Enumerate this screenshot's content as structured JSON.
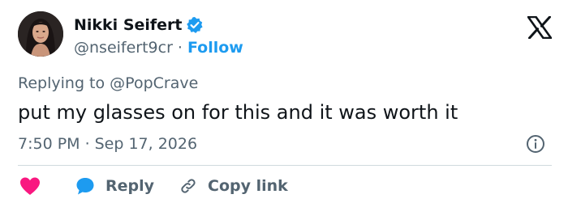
{
  "author": {
    "display_name": "Nikki Seifert",
    "handle": "@nseifert9cr",
    "separator": "·",
    "follow_label": "Follow"
  },
  "replying": {
    "prefix": "Replying to",
    "mention": "@PopCrave"
  },
  "tweet": {
    "text": "put my glasses on for this and it was worth it",
    "time": "7:50 PM",
    "separator": "·",
    "date": "Sep 17, 2026"
  },
  "actions": {
    "reply_label": "Reply",
    "copy_link_label": "Copy link"
  },
  "colors": {
    "accent": "#1d9bf0",
    "like": "#f91880",
    "muted": "#536471",
    "text": "#0f1419",
    "divider": "#cfd9de"
  },
  "icons": [
    "verified-badge-icon",
    "x-logo-icon",
    "info-icon",
    "heart-icon",
    "reply-bubble-icon",
    "link-icon"
  ]
}
